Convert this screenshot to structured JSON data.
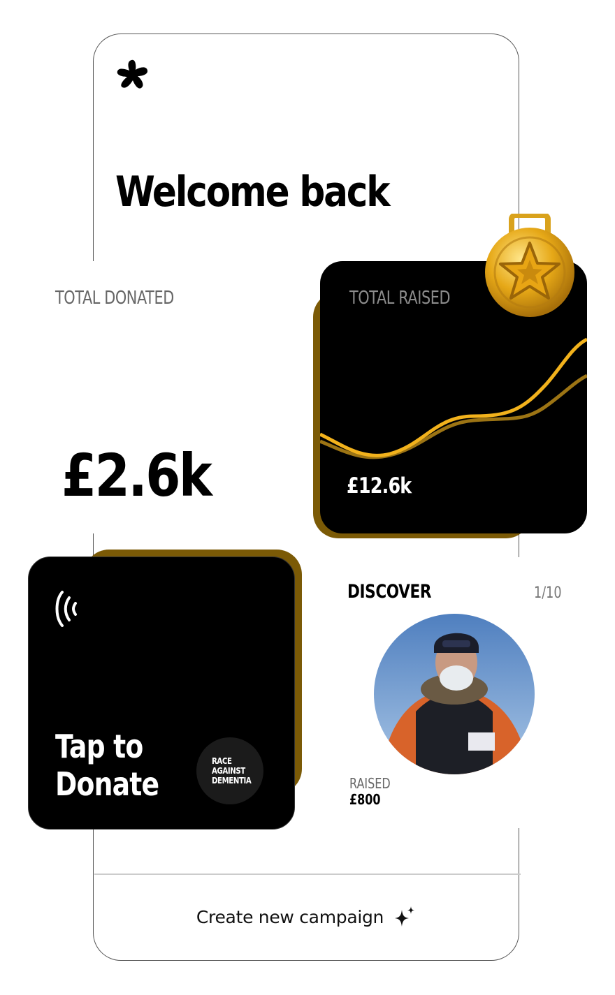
{
  "header": {
    "greeting": "Welcome back"
  },
  "stats": {
    "total_donated_label": "TOTAL DONATED",
    "total_donated_value": "£2.6k",
    "total_raised_label": "TOTAL RAISED",
    "total_raised_value": "£12.6k"
  },
  "tap_card": {
    "line1": "Tap to",
    "line2": "Donate",
    "charity_line1": "RACE",
    "charity_line2": "AGAINST",
    "charity_line3": "DEMENTIA"
  },
  "discover": {
    "label": "DISCOVER",
    "page_indicator": "1/10",
    "raised_label": "RAISED",
    "raised_value": "£800"
  },
  "footer": {
    "create_label": "Create new campaign"
  },
  "icons": {
    "logo": "brand-flower-icon",
    "medal": "gold-star-medal-icon",
    "nfc": "contactless-icon",
    "sparkle": "sparkle-icon"
  },
  "colors": {
    "accent_gold": "#f2b21c",
    "shadow_gold": "#7b5a06",
    "card_black": "#000000"
  }
}
